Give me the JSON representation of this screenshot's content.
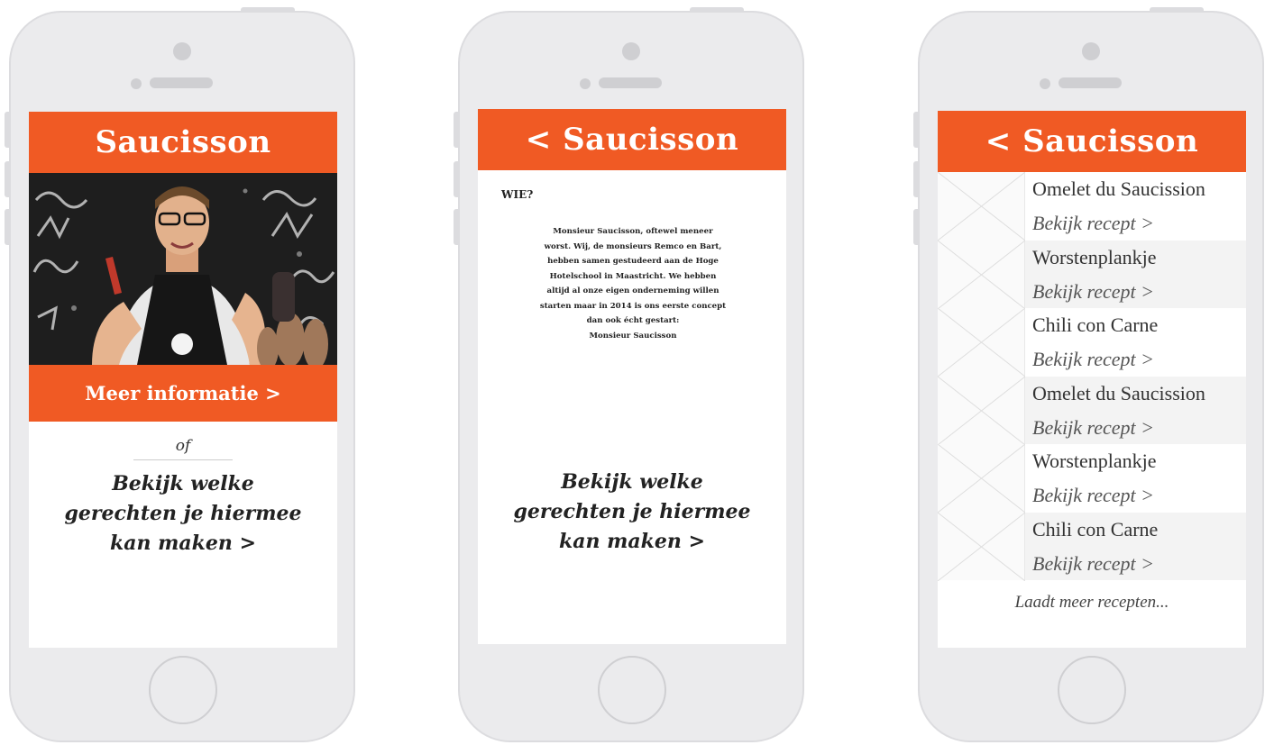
{
  "colors": {
    "accent": "#f05a24",
    "phone_body": "#ebebed",
    "screen": "#ffffff"
  },
  "phone1": {
    "header_title": "Saucisson",
    "info_button": "Meer informatie >",
    "or_label": "of",
    "cta_lines": [
      "Bekijk welke",
      "gerechten je hiermee",
      "kan maken >"
    ],
    "hero_image": "photo-man-holding-sausages"
  },
  "phone2": {
    "header_title": "< Saucisson",
    "section_label": "WIE?",
    "about_lines": [
      "Monsieur Saucisson, oftewel meneer",
      "worst. Wij, de monsieurs Remco en Bart,",
      "hebben samen gestudeerd aan de Hoge",
      "Hotelschool in Maastricht. We hebben",
      "altijd al onze eigen onderneming willen",
      "starten maar in 2014 is ons eerste concept",
      "dan ook écht gestart:",
      "Monsieur Saucisson"
    ],
    "cta_lines": [
      "Bekijk welke",
      "gerechten je hiermee",
      "kan maken >"
    ]
  },
  "phone3": {
    "header_title": "< Saucisson",
    "recipes": [
      {
        "name": "Omelet du Saucission",
        "link": "Bekijk recept >"
      },
      {
        "name": "Worstenplankje",
        "link": "Bekijk recept >"
      },
      {
        "name": "Chili con Carne",
        "link": "Bekijk recept >"
      },
      {
        "name": "Omelet du Saucission",
        "link": "Bekijk recept >"
      },
      {
        "name": "Worstenplankje",
        "link": "Bekijk recept >"
      },
      {
        "name": "Chili con Carne",
        "link": "Bekijk recept >"
      }
    ],
    "load_more": "Laadt meer recepten..."
  }
}
